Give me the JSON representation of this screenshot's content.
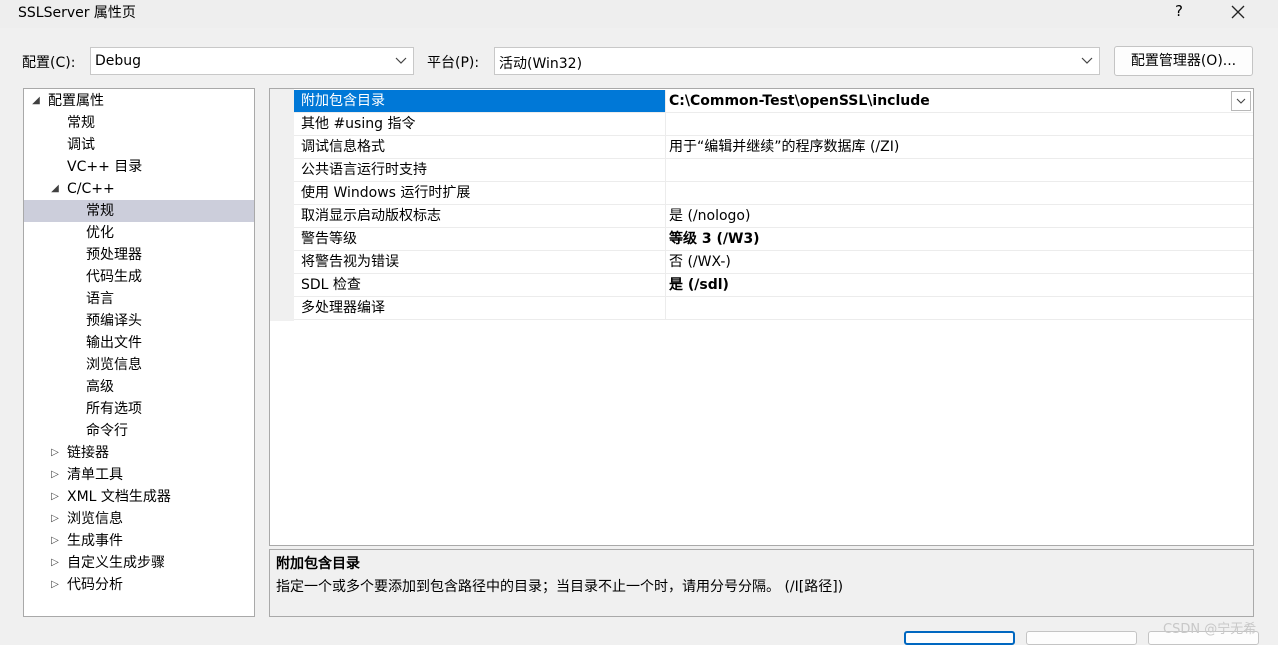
{
  "window": {
    "title": "SSLServer 属性页",
    "help": "?"
  },
  "toolbar": {
    "config_label": "配置(C):",
    "config_value": "Debug",
    "platform_label": "平台(P):",
    "platform_value": "活动(Win32)",
    "config_manager": "配置管理器(O)..."
  },
  "tree": [
    {
      "label": "配置属性",
      "level": 0,
      "state": "expanded"
    },
    {
      "label": "常规",
      "level": 1,
      "state": "leaf"
    },
    {
      "label": "调试",
      "level": 1,
      "state": "leaf"
    },
    {
      "label": "VC++ 目录",
      "level": 1,
      "state": "leaf"
    },
    {
      "label": "C/C++",
      "level": 1,
      "state": "expanded"
    },
    {
      "label": "常规",
      "level": 2,
      "state": "leaf",
      "selected": true
    },
    {
      "label": "优化",
      "level": 2,
      "state": "leaf"
    },
    {
      "label": "预处理器",
      "level": 2,
      "state": "leaf"
    },
    {
      "label": "代码生成",
      "level": 2,
      "state": "leaf"
    },
    {
      "label": "语言",
      "level": 2,
      "state": "leaf"
    },
    {
      "label": "预编译头",
      "level": 2,
      "state": "leaf"
    },
    {
      "label": "输出文件",
      "level": 2,
      "state": "leaf"
    },
    {
      "label": "浏览信息",
      "level": 2,
      "state": "leaf"
    },
    {
      "label": "高级",
      "level": 2,
      "state": "leaf"
    },
    {
      "label": "所有选项",
      "level": 2,
      "state": "leaf"
    },
    {
      "label": "命令行",
      "level": 2,
      "state": "leaf"
    },
    {
      "label": "链接器",
      "level": 1,
      "state": "collapsed"
    },
    {
      "label": "清单工具",
      "level": 1,
      "state": "collapsed"
    },
    {
      "label": "XML 文档生成器",
      "level": 1,
      "state": "collapsed"
    },
    {
      "label": "浏览信息",
      "level": 1,
      "state": "collapsed"
    },
    {
      "label": "生成事件",
      "level": 1,
      "state": "collapsed"
    },
    {
      "label": "自定义生成步骤",
      "level": 1,
      "state": "collapsed"
    },
    {
      "label": "代码分析",
      "level": 1,
      "state": "collapsed"
    }
  ],
  "properties": [
    {
      "name": "附加包含目录",
      "value": "C:\\Common-Test\\openSSL\\include",
      "bold": true,
      "selected": true
    },
    {
      "name": "其他 #using 指令",
      "value": "",
      "bold": false
    },
    {
      "name": "调试信息格式",
      "value": "用于“编辑并继续”的程序数据库 (/ZI)",
      "bold": false
    },
    {
      "name": "公共语言运行时支持",
      "value": "",
      "bold": false
    },
    {
      "name": "使用 Windows 运行时扩展",
      "value": "",
      "bold": false
    },
    {
      "name": "取消显示启动版权标志",
      "value": "是 (/nologo)",
      "bold": false
    },
    {
      "name": "警告等级",
      "value": "等级 3 (/W3)",
      "bold": true
    },
    {
      "name": "将警告视为错误",
      "value": "否 (/WX-)",
      "bold": false
    },
    {
      "name": "SDL 检查",
      "value": "是 (/sdl)",
      "bold": true
    },
    {
      "name": "多处理器编译",
      "value": "",
      "bold": false
    }
  ],
  "description": {
    "title": "附加包含目录",
    "text": "指定一个或多个要添加到包含路径中的目录；当目录不止一个时，请用分号分隔。     (/I[路径])"
  },
  "watermark": "CSDN @宁无希",
  "colors": {
    "selection": "#0078d7",
    "tree_selection": "#cccedb",
    "primary_button_border": "#0067c0"
  }
}
